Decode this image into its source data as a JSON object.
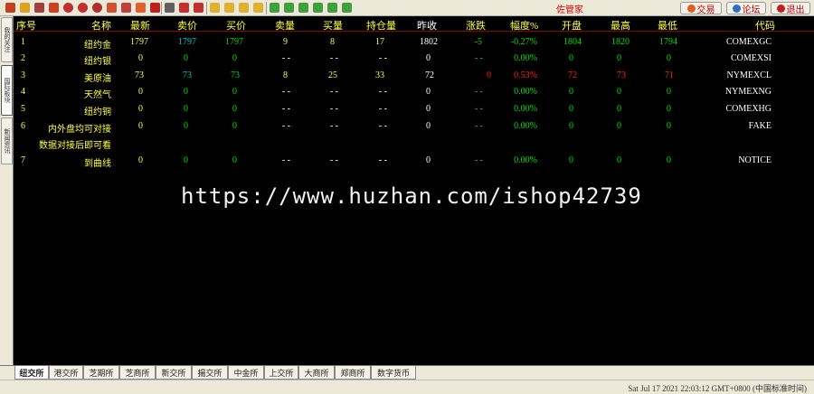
{
  "app": {
    "title": "佐管家",
    "buttons": {
      "trade": "交易",
      "forum": "论坛",
      "exit": "退出"
    }
  },
  "side_tabs": [
    "我的关注",
    "国际板块",
    "新闻资讯"
  ],
  "table": {
    "headers": [
      "序号",
      "名称",
      "最新",
      "卖价",
      "买价",
      "卖量",
      "买量",
      "持仓量",
      "昨收",
      "涨跌",
      "幅度%",
      "开盘",
      "最高",
      "最低",
      "代码"
    ],
    "rows": [
      {
        "idx": "1",
        "name": "纽约金",
        "last": "1797",
        "ask": "1797",
        "bid": "1797",
        "askvol": "9",
        "bidvol": "8",
        "oi": "17",
        "prev": "1802",
        "chg": "-5",
        "pct": "-0.27%",
        "open": "1804",
        "high": "1820",
        "low": "1794",
        "code": "COMEXGC"
      },
      {
        "idx": "2",
        "name": "纽约银",
        "last": "0",
        "ask": "0",
        "bid": "0",
        "askvol": "- -",
        "bidvol": "- -",
        "oi": "- -",
        "prev": "0",
        "chg": "- -",
        "pct": "0.00%",
        "open": "0",
        "high": "0",
        "low": "0",
        "code": "COMEXSI"
      },
      {
        "idx": "3",
        "name": "美原油",
        "last": "73",
        "ask": "73",
        "bid": "73",
        "askvol": "8",
        "bidvol": "25",
        "oi": "33",
        "prev": "72",
        "chg": "0",
        "pct": "0.53%",
        "open": "72",
        "high": "73",
        "low": "71",
        "code": "NYMEXCL"
      },
      {
        "idx": "4",
        "name": "天然气",
        "last": "0",
        "ask": "0",
        "bid": "0",
        "askvol": "- -",
        "bidvol": "- -",
        "oi": "- -",
        "prev": "0",
        "chg": "- -",
        "pct": "0.00%",
        "open": "0",
        "high": "0",
        "low": "0",
        "code": "NYMEXNG"
      },
      {
        "idx": "5",
        "name": "纽约铜",
        "last": "0",
        "ask": "0",
        "bid": "0",
        "askvol": "- -",
        "bidvol": "- -",
        "oi": "- -",
        "prev": "0",
        "chg": "- -",
        "pct": "0.00%",
        "open": "0",
        "high": "0",
        "low": "0",
        "code": "COMEXHG"
      },
      {
        "idx": "6",
        "name": "内外盘均可对接",
        "last": "0",
        "ask": "0",
        "bid": "0",
        "askvol": "- -",
        "bidvol": "- -",
        "oi": "- -",
        "prev": "0",
        "chg": "- -",
        "pct": "0.00%",
        "open": "0",
        "high": "0",
        "low": "0",
        "code": "FAKE"
      },
      {
        "idx": "",
        "name": "数据对接后即可看",
        "last": "",
        "ask": "",
        "bid": "",
        "askvol": "",
        "bidvol": "",
        "oi": "",
        "prev": "",
        "chg": "",
        "pct": "",
        "open": "",
        "high": "",
        "low": "",
        "code": ""
      },
      {
        "idx": "7",
        "name": "到曲线",
        "last": "0",
        "ask": "0",
        "bid": "0",
        "askvol": "- -",
        "bidvol": "- -",
        "oi": "- -",
        "prev": "0",
        "chg": "- -",
        "pct": "0.00%",
        "open": "0",
        "high": "0",
        "low": "0",
        "code": "NOTICE"
      }
    ]
  },
  "watermark": "https://www.huzhan.com/ishop42739",
  "bottom_tabs": [
    "纽交所",
    "港交所",
    "芝期所",
    "芝商所",
    "新交所",
    "揚交所",
    "中金所",
    "上交所",
    "大商所",
    "郑商所",
    "数字货币"
  ],
  "status": {
    "datetime": "Sat Jul 17 2021 22:03:12 GMT+0800 (中国标准时间)"
  },
  "colors": {
    "header_text": "#ffff40",
    "up": "#ff2020",
    "down": "#00e000",
    "neutral": "#ffffff",
    "background": "#000000"
  }
}
